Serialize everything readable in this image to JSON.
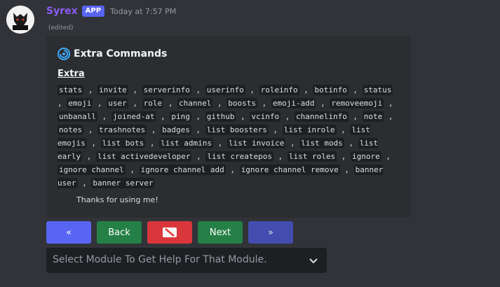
{
  "message": {
    "username": "Syrex",
    "badge": "APP",
    "timestamp": "Today at 7:57 PM",
    "edited": "(edited)",
    "avatar_text": "SYREX"
  },
  "embed": {
    "title": "Extra Commands",
    "field_name": "Extra",
    "commands": [
      "stats",
      "invite",
      "serverinfo",
      "userinfo",
      "roleinfo",
      "botinfo",
      "status",
      "emoji",
      "user",
      "role",
      "channel",
      "boosts",
      "emoji-add",
      "removeemoji",
      "unbanall",
      "joined-at",
      "ping",
      "github",
      "vcinfo",
      "channelinfo",
      "note",
      "notes",
      "trashnotes",
      "badges",
      "list boosters",
      "list inrole",
      "list emojis",
      "list bots",
      "list admins",
      "list invoice",
      "list mods",
      "list early",
      "list activedeveloper",
      "list createpos",
      "list roles",
      "ignore",
      "ignore channel",
      "ignore channel add",
      "ignore channel remove",
      "banner user",
      "banner server"
    ],
    "footer": "Thanks for using me!"
  },
  "buttons": {
    "first": "«",
    "back": "Back",
    "stop_icon": "stop-icon",
    "next": "Next",
    "last": "»"
  },
  "select": {
    "placeholder": "Select Module To Get Help For That Module."
  },
  "colors": {
    "username": "#8b5cf6",
    "badge": "#5865f2",
    "primary": "#5865f2",
    "success": "#248046",
    "danger": "#da373c"
  }
}
